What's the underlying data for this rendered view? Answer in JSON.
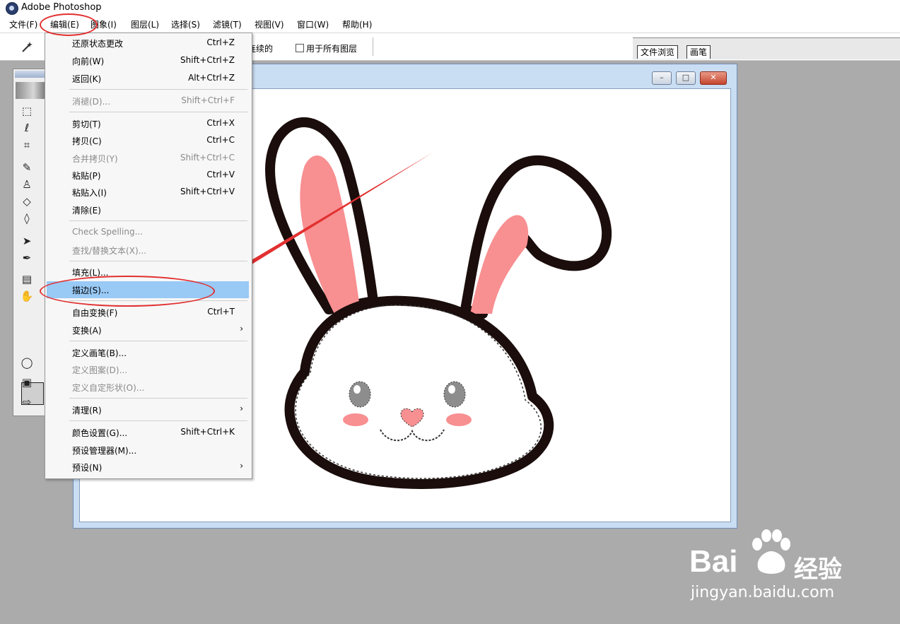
{
  "app": {
    "title": "Adobe Photoshop"
  },
  "menubar": {
    "items": [
      "文件(F)",
      "编辑(E)",
      "图象(I)",
      "图层(L)",
      "选择(S)",
      "滤镜(T)",
      "视图(V)",
      "窗口(W)",
      "帮助(H)"
    ]
  },
  "options": {
    "contiguous": "连续的",
    "all_layers": "用于所有图层"
  },
  "palette_well": {
    "tabs": [
      "文件浏览",
      "画笔"
    ]
  },
  "edit_menu": {
    "items": [
      {
        "label": "还原状态更改",
        "shortcut": "Ctrl+Z"
      },
      {
        "label": "向前(W)",
        "shortcut": "Shift+Ctrl+Z"
      },
      {
        "label": "返回(K)",
        "shortcut": "Alt+Ctrl+Z"
      },
      {
        "label": "消褪(D)...",
        "shortcut": "Shift+Ctrl+F"
      },
      {
        "label": "剪切(T)",
        "shortcut": "Ctrl+X"
      },
      {
        "label": "拷贝(C)",
        "shortcut": "Ctrl+C"
      },
      {
        "label": "合并拷贝(Y)",
        "shortcut": "Shift+Ctrl+C"
      },
      {
        "label": "粘贴(P)",
        "shortcut": "Ctrl+V"
      },
      {
        "label": "粘贴入(I)",
        "shortcut": "Shift+Ctrl+V"
      },
      {
        "label": "清除(E)",
        "shortcut": ""
      },
      {
        "label": "Check Spelling...",
        "shortcut": ""
      },
      {
        "label": "查找/替换文本(X)...",
        "shortcut": ""
      },
      {
        "label": "填充(L)...",
        "shortcut": ""
      },
      {
        "label": "描边(S)...",
        "shortcut": ""
      },
      {
        "label": "自由变换(F)",
        "shortcut": "Ctrl+T"
      },
      {
        "label": "变换(A)",
        "shortcut": ""
      },
      {
        "label": "定义画笔(B)...",
        "shortcut": ""
      },
      {
        "label": "定义图案(D)...",
        "shortcut": ""
      },
      {
        "label": "定义自定形状(O)...",
        "shortcut": ""
      },
      {
        "label": "清理(R)",
        "shortcut": ""
      },
      {
        "label": "颜色设置(G)...",
        "shortcut": "Shift+Ctrl+K"
      },
      {
        "label": "预设管理器(M)...",
        "shortcut": ""
      },
      {
        "label": "预设(N)",
        "shortcut": ""
      }
    ]
  },
  "window_buttons": {
    "minimize": "–",
    "maximize": "□",
    "close": "✕"
  },
  "watermark": {
    "brand": "Bai",
    "brand_tail": "经验",
    "url": "jingyan.baidu.com"
  },
  "colors": {
    "highlight": "#99c9f5",
    "annotation": "#e23030",
    "ear_pink": "#f88f91",
    "background": "#ababab"
  }
}
